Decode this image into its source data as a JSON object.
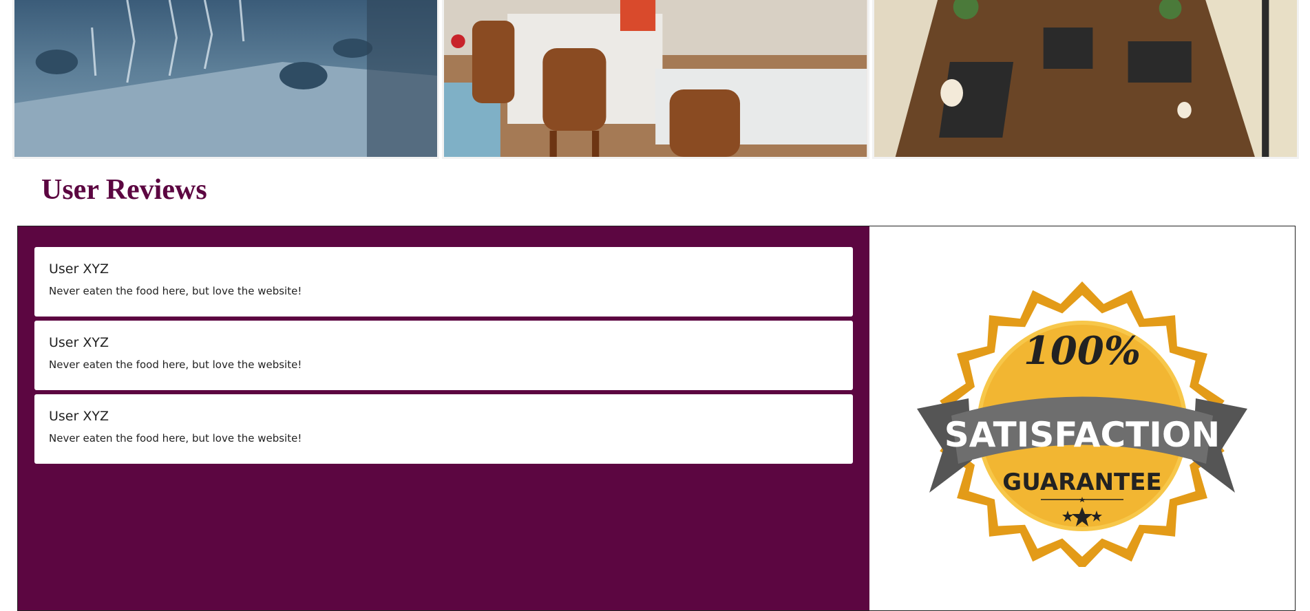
{
  "gallery": {
    "photos": [
      {
        "name": "table-setting-photo"
      },
      {
        "name": "restaurant-interior-photo"
      },
      {
        "name": "overhead-cafe-photo"
      }
    ]
  },
  "reviews": {
    "title": "User Reviews",
    "items": [
      {
        "user": "User XYZ",
        "text": "Never eaten the food here, but love the website!"
      },
      {
        "user": "User XYZ",
        "text": "Never eaten the food here, but love the website!"
      },
      {
        "user": "User XYZ",
        "text": "Never eaten the food here, but love the website!"
      }
    ]
  },
  "badge": {
    "percent": "100%",
    "line1": "SATISFACTION",
    "line2": "GUARANTEE"
  },
  "colors": {
    "brand": "#5c0641",
    "gold": "#f2b632",
    "gold_dark": "#e39b18",
    "ribbon": "#6e6e6e",
    "ribbon_dark": "#3f3f3f"
  }
}
